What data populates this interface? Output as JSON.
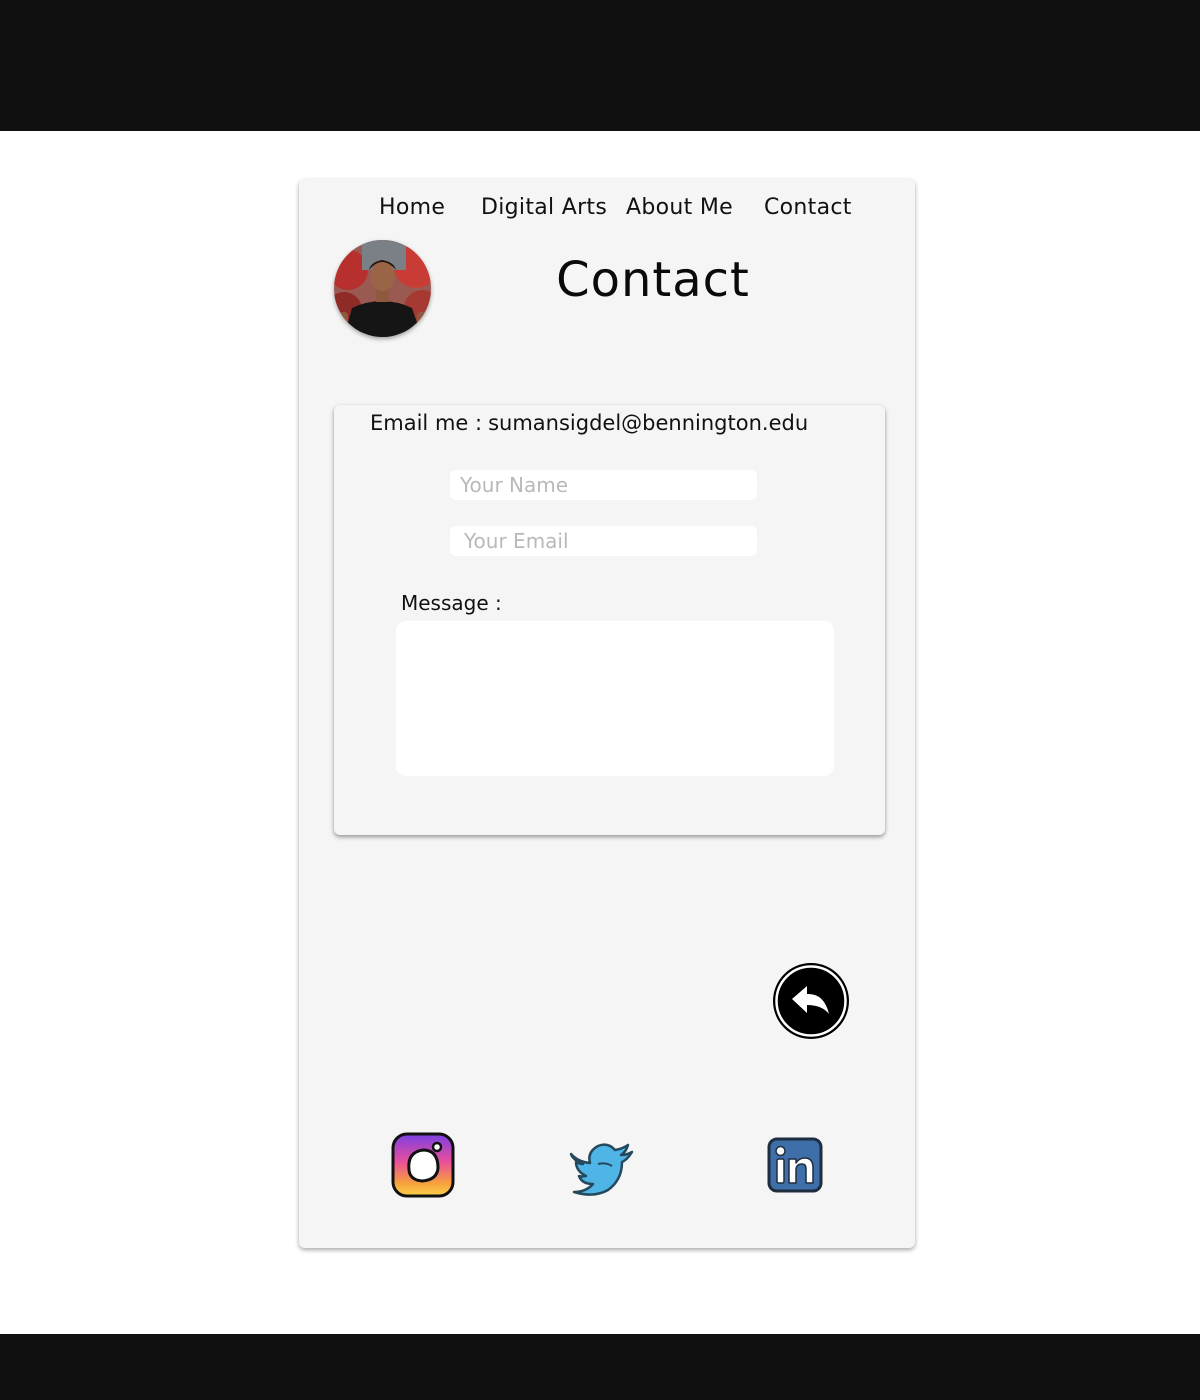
{
  "nav": {
    "home": "Home",
    "digital_arts": "Digital Arts",
    "about_me": "About Me",
    "contact": "Contact"
  },
  "page": {
    "title": "Contact"
  },
  "contact_form": {
    "email_label": "Email me :",
    "email_address": "sumansigdel@bennington.edu",
    "name_placeholder": "Your Name",
    "email_placeholder": "Your Email",
    "message_label": "Message :",
    "message_value": ""
  },
  "icons": {
    "back": "reply-arrow-icon",
    "instagram": "instagram-icon",
    "twitter": "twitter-icon",
    "linkedin": "linkedin-icon",
    "avatar": "profile-photo"
  },
  "colors": {
    "page_bg": "#ffffff",
    "bars": "#0f0f10",
    "card_bg": "#f5f5f5",
    "twitter_blue": "#4fb4e6",
    "linkedin_blue": "#3f6fa8"
  }
}
